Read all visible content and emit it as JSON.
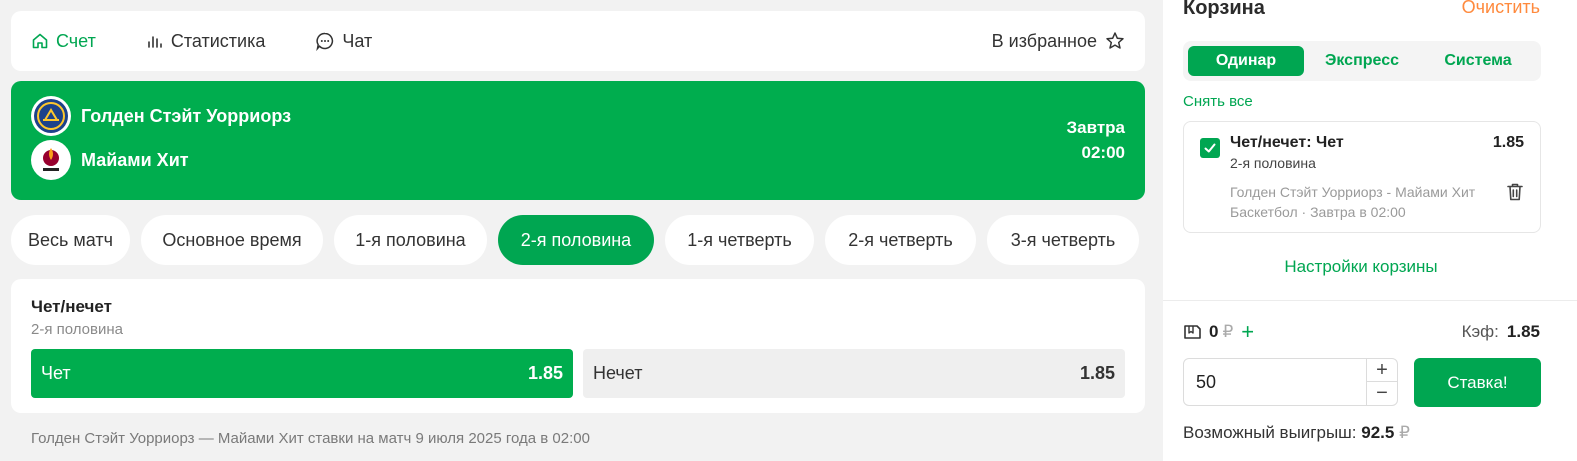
{
  "nav": {
    "score_label": "Счет",
    "stats_label": "Статистика",
    "chat_label": "Чат",
    "favorite_label": "В избранное"
  },
  "match": {
    "team1": "Голден Стэйт Уорриорз",
    "team2": "Майами Хит",
    "day": "Завтра",
    "time": "02:00"
  },
  "periods": [
    {
      "label": "Весь матч",
      "active": false
    },
    {
      "label": "Основное время",
      "active": false
    },
    {
      "label": "1-я половина",
      "active": false
    },
    {
      "label": "2-я половина",
      "active": true
    },
    {
      "label": "1-я четверть",
      "active": false
    },
    {
      "label": "2-я четверть",
      "active": false
    },
    {
      "label": "3-я четверть",
      "active": false
    }
  ],
  "market": {
    "title": "Чет/нечет",
    "subtitle": "2-я половина",
    "outcomes": [
      {
        "label": "Чет",
        "odd": "1.85",
        "selected": true
      },
      {
        "label": "Нечет",
        "odd": "1.85",
        "selected": false
      }
    ]
  },
  "footer_note": "Голден Стэйт Уорриорз — Майами Хит ставки на матч 9 июля 2025 года в 02:00",
  "cart": {
    "title": "Корзина",
    "clear_label": "Очистить",
    "tabs": [
      {
        "label": "Одинар",
        "active": true
      },
      {
        "label": "Экспресс",
        "active": false
      },
      {
        "label": "Система",
        "active": false
      }
    ],
    "remove_all_label": "Снять все",
    "bet": {
      "name": "Чет/нечет: Чет",
      "odd": "1.85",
      "period": "2-я половина",
      "match": "Голден Стэйт Уорриорз - Майами Хит",
      "sport_time": "Баскетбол · Завтра в 02:00"
    },
    "settings_label": "Настройки корзины",
    "balance": "0",
    "currency": "₽",
    "coef_label": "Кэф:",
    "coef_value": "1.85",
    "amount": "50",
    "stake_label": "Ставка!",
    "win_label": "Возможный выигрыш:",
    "win_value": "92.5"
  },
  "colors": {
    "accent": "#00a651",
    "match_card": "#00ad4e",
    "clear": "#ff8a3d"
  }
}
